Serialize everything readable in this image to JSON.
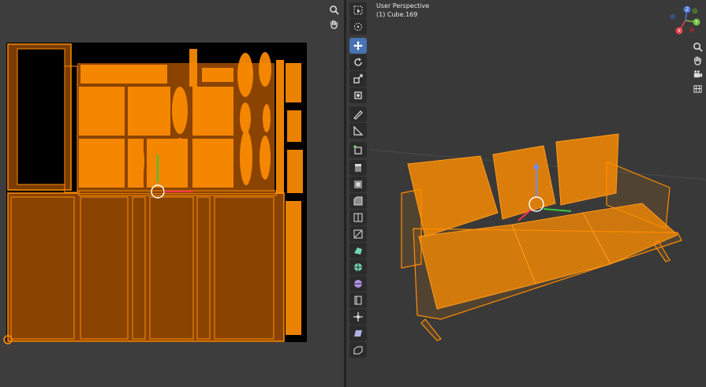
{
  "viewport": {
    "view_name": "User Perspective",
    "object_name": "(1) Cube.169"
  },
  "uv_editor": {
    "nav_icons": [
      "zoom-icon",
      "hand-pan-icon"
    ]
  },
  "toolbar": {
    "tools": [
      "select-box-icon",
      "cursor-icon",
      "move-icon",
      "rotate-icon",
      "scale-icon",
      "transform-icon",
      "annotate-icon",
      "measure-icon",
      "add-cube-icon",
      "extrude-region-icon",
      "inset-faces-icon",
      "bevel-icon",
      "loop-cut-icon",
      "knife-icon",
      "poly-build-icon",
      "spin-icon",
      "smooth-vertices-icon",
      "edge-slide-icon",
      "shrink-fatten-icon",
      "shear-icon",
      "rip-region-icon"
    ],
    "active_tool": "move-icon"
  },
  "gizmo": {
    "axes": [
      "X",
      "Y",
      "Z"
    ]
  },
  "colors": {
    "selection": "#ff8c00",
    "active_tool": "#4772b3",
    "background": "#393939"
  }
}
